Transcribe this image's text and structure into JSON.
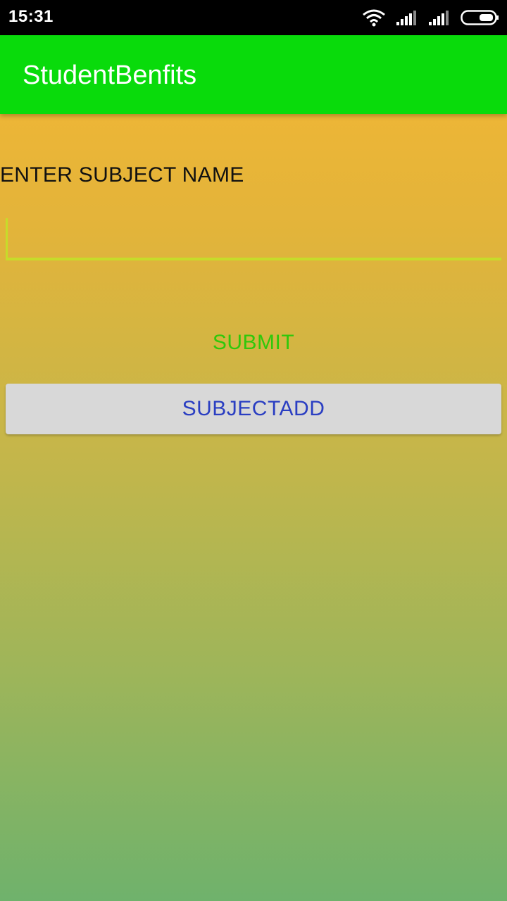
{
  "status_bar": {
    "time": "15:31",
    "icons": [
      "wifi-icon",
      "signal-icon",
      "signal-icon",
      "battery-icon"
    ]
  },
  "app_bar": {
    "title": "StudentBenfits",
    "color": "#09db0b"
  },
  "form": {
    "label": "ENTER SUBJECT NAME",
    "input_value": "",
    "input_placeholder": "",
    "submit_label": "SUBMIT",
    "subjectadd_label": "SUBJECTADD"
  },
  "colors": {
    "accent": "#c6dc2a",
    "submit_text": "#2fc80a",
    "subjectadd_text": "#2a3ec2",
    "gradient_top": "#f6b733",
    "gradient_bottom": "#6fb26c"
  }
}
